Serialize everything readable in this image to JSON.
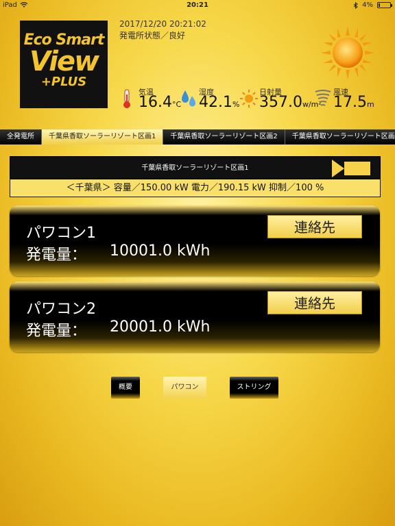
{
  "status_bar": {
    "device": "iPad",
    "time": "20:21",
    "battery": "4%",
    "battery_level": 0.04
  },
  "logo": {
    "line1": "Eco Smart",
    "line2": "View",
    "line3": "+PLUS"
  },
  "header": {
    "datetime": "2017/12/20 20:21:02",
    "plant_status": "発電所状態／良好"
  },
  "metrics": {
    "temperature": {
      "label": "気温",
      "value": "16.4",
      "unit": "°C"
    },
    "humidity": {
      "label": "湿度",
      "value": "42.1",
      "unit": "%"
    },
    "irradiance": {
      "label": "日射量",
      "value": "357.0",
      "unit": "w/m²"
    },
    "wind": {
      "label": "風速",
      "value": "17.5",
      "unit": "m"
    }
  },
  "tabs": [
    {
      "label": "全発電所"
    },
    {
      "label": "千葉県香取ソーラーリゾート区画1"
    },
    {
      "label": "千葉県香取ソーラーリゾート区画2"
    },
    {
      "label": "千葉県香取ソーラーリゾート区画3"
    }
  ],
  "panel": {
    "title": "千葉県香取ソーラーリゾート区画1",
    "summary": "＜千葉県＞ 容量／150.00 kW 電力／190.15 kW 抑制／100 %"
  },
  "pcs": [
    {
      "name": "パワコン1",
      "gen_label": "発電量：",
      "gen_value": "10001.0 kWh",
      "contact": "連絡先"
    },
    {
      "name": "パワコン2",
      "gen_label": "発電量：",
      "gen_value": "20001.0 kWh",
      "contact": "連絡先"
    }
  ],
  "bottom_buttons": {
    "overview": "概要",
    "pcs": "パワコン",
    "string": "ストリング"
  }
}
